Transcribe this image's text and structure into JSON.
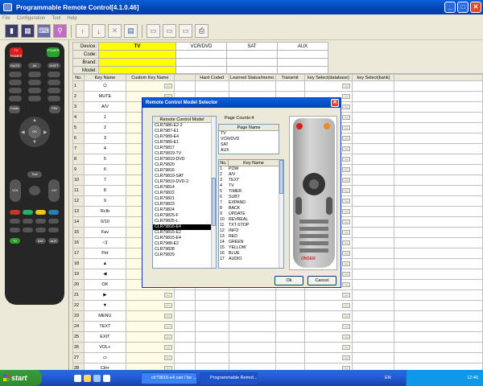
{
  "window": {
    "title": "Programmable Remote Control[4.1.0.46]"
  },
  "menu": [
    "File",
    "Configuration",
    "Tool",
    "Help"
  ],
  "devices": {
    "label": "Device:",
    "tv": "TV",
    "vcr": "VCR/DVD",
    "sat": "SAT",
    "aux": "AUX"
  },
  "fields": {
    "code": "Code:",
    "brand": "Brand:",
    "model": "Model:"
  },
  "columns": [
    "No.",
    "Key Name",
    "Custom Key Name",
    "",
    "Hard Coded",
    "Learned Status/memo",
    "Transmit",
    "key Select(database)",
    "key Select(bank)"
  ],
  "rows": [
    {
      "no": "1",
      "key": "⏻"
    },
    {
      "no": "2",
      "key": "MUTE"
    },
    {
      "no": "3",
      "key": "A/V"
    },
    {
      "no": "4",
      "key": "1"
    },
    {
      "no": "5",
      "key": "2"
    },
    {
      "no": "6",
      "key": "3"
    },
    {
      "no": "7",
      "key": "4"
    },
    {
      "no": "8",
      "key": "5"
    },
    {
      "no": "9",
      "key": "6"
    },
    {
      "no": "10",
      "key": "7"
    },
    {
      "no": "11",
      "key": "8"
    },
    {
      "no": "12",
      "key": "9"
    },
    {
      "no": "13",
      "key": "Rclb"
    },
    {
      "no": "14",
      "key": "0/10"
    },
    {
      "no": "15",
      "key": "Fav"
    },
    {
      "no": "16",
      "key": "◁)"
    },
    {
      "no": "17",
      "key": "Pet"
    },
    {
      "no": "18",
      "key": "▲"
    },
    {
      "no": "19",
      "key": "◀"
    },
    {
      "no": "20",
      "key": "OK"
    },
    {
      "no": "21",
      "key": "▶"
    },
    {
      "no": "22",
      "key": "▼"
    },
    {
      "no": "23",
      "key": "MENU"
    },
    {
      "no": "24",
      "key": "TEXT"
    },
    {
      "no": "25",
      "key": "EXIT"
    },
    {
      "no": "26",
      "key": "VOL+"
    },
    {
      "no": "27",
      "key": "▭"
    },
    {
      "no": "28",
      "key": "CH+"
    }
  ],
  "dialog": {
    "title": "Remote Control Model Selector",
    "model_header": "Remote Control Model",
    "models": [
      "CLR7986-E2-2",
      "CLR7987-E1",
      "CLR7989-E4",
      "CLR7989-E1",
      "CLR79817",
      "CLR79819-TV",
      "CLR79819-DVD",
      "CLR79820",
      "CLR79816",
      "CLR79819-SAT",
      "CLR79819-DVD-2",
      "CLR79814",
      "CLR79822",
      "CLR79821",
      "CLR79823",
      "CLR79824",
      "CLR79825-F",
      "CLR79825-L",
      "CLR79816-E4",
      "CLR79815-E2",
      "CLR79815-E4",
      "CLR7988-E2",
      "CLR79828",
      "CLR79829"
    ],
    "selected_model": "CLR79816-E4",
    "page_counts": "Page Counts:4",
    "page_header": "Page Name",
    "pages": [
      "TV",
      "VCR/DVD",
      "SAT",
      "AUX"
    ],
    "key_no_header": "No.",
    "key_name_header": "Key Name",
    "keys": [
      [
        "1",
        "POW"
      ],
      [
        "2",
        "A/V"
      ],
      [
        "3",
        "TEXT"
      ],
      [
        "4",
        "TV"
      ],
      [
        "5",
        "TIMER"
      ],
      [
        "6",
        "SUBT"
      ],
      [
        "7",
        "EXPAND"
      ],
      [
        "8",
        "BACK"
      ],
      [
        "9",
        "UPDATE"
      ],
      [
        "10",
        "REVREAL"
      ],
      [
        "11",
        "TXT-STOP"
      ],
      [
        "12",
        "INFO"
      ],
      [
        "13",
        "RED"
      ],
      [
        "14",
        "GREEN"
      ],
      [
        "15",
        "YELLOW"
      ],
      [
        "16",
        "BLUE"
      ],
      [
        "17",
        "AUDIO"
      ]
    ],
    "brand_text": "ONSER",
    "ok": "Ok",
    "cancel": "Cancel"
  },
  "taskbar": {
    "start": "start",
    "tasks": [
      "clr79816-e4 can / be ...",
      "Programmable Remot..."
    ],
    "lang": "EN",
    "clock": "12:46"
  },
  "remote": {
    "buttons": [
      "TV POWER",
      "POWER",
      "MUTE",
      "AV",
      "SHIFT",
      "Guide",
      "FAV",
      "OK",
      "Text",
      "VOL",
      "CH",
      "TV",
      "SAT",
      "AUX"
    ]
  },
  "colors": {
    "selected_device": "#ffff00",
    "title_blue": "#0244b5",
    "power_red": "#d62020",
    "power_green": "#2aa02a"
  }
}
